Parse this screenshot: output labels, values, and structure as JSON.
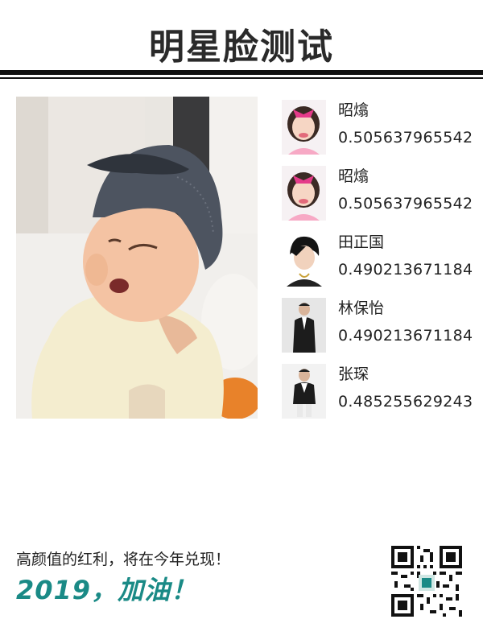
{
  "header": {
    "title": "明星脸测试"
  },
  "photo": {
    "subject": "toddler in grey cap"
  },
  "matches": [
    {
      "name": "昭熻",
      "score": "0.505637965542",
      "icon": "celebrity-portrait-pink-bow"
    },
    {
      "name": "昭熻",
      "score": "0.505637965542",
      "icon": "celebrity-portrait-pink-bow"
    },
    {
      "name": "田正国",
      "score": "0.490213671184",
      "icon": "celebrity-portrait-black-hair"
    },
    {
      "name": "林保怡",
      "score": "0.490213671184",
      "icon": "celebrity-portrait-suit"
    },
    {
      "name": "张琛",
      "score": "0.485255629243",
      "icon": "celebrity-portrait-suit"
    }
  ],
  "footer": {
    "tagline": "高颜值的红利，将在今年兑现！",
    "slogan": "2019，加油！",
    "slogan_color": "#1a8a86"
  },
  "qr": {
    "icon": "qr-code-icon"
  }
}
